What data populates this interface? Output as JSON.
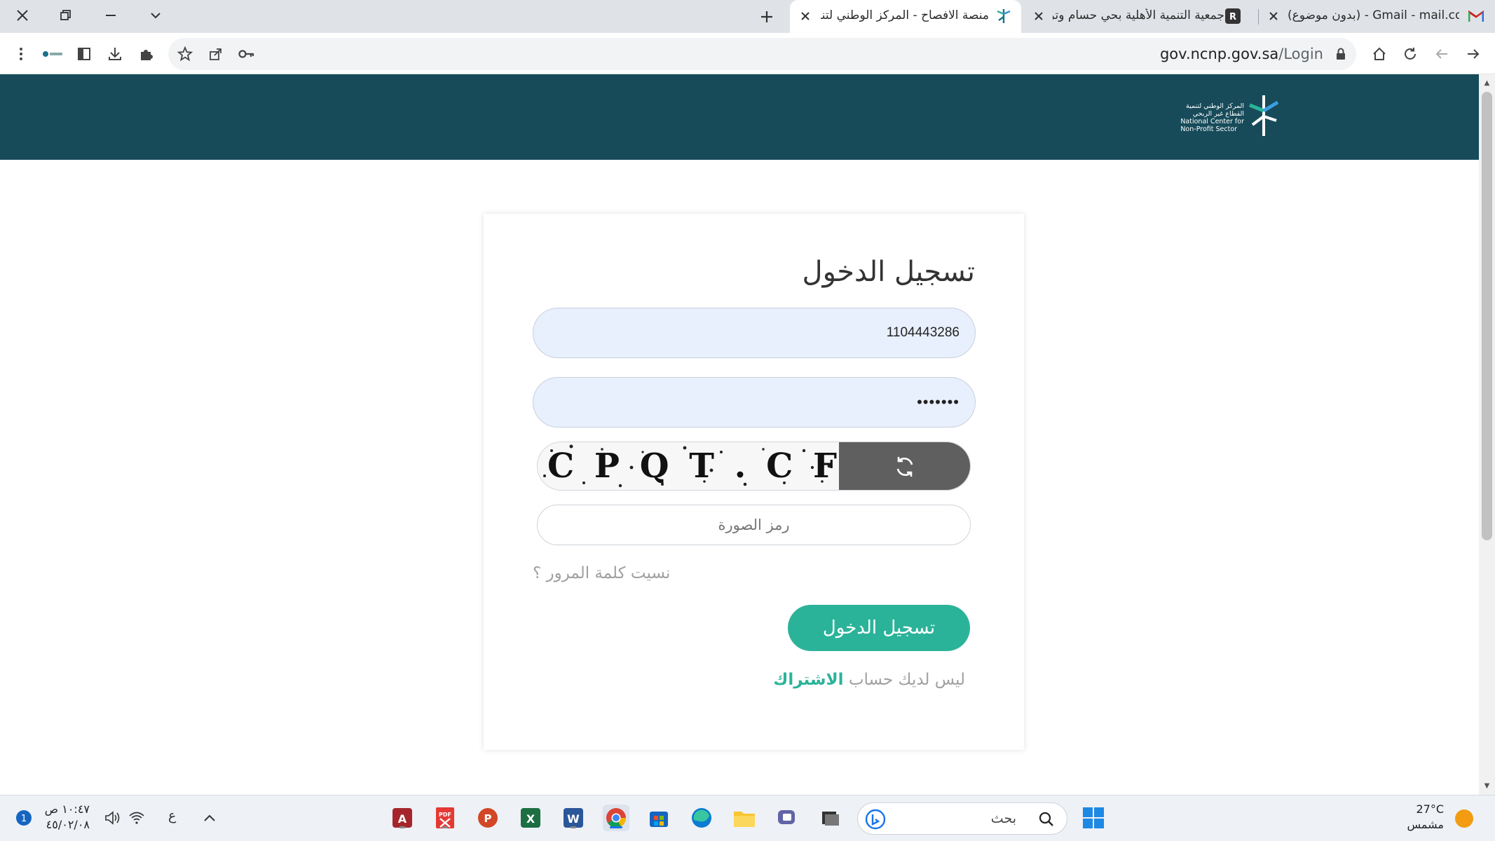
{
  "browser": {
    "tabs": [
      {
        "title": "منصة الافصاح - المركز الوطني لتنمية",
        "active": true
      },
      {
        "title": "جمعية التنمية الأهلية بحي حسام وتر",
        "active": false
      },
      {
        "title": "(بدون موضوع) - Gmail - mail.com",
        "active": false
      }
    ],
    "url_host": "gov.ncnp.gov.sa",
    "url_path": "/Login"
  },
  "header": {
    "logo_text_ar_1": "المركز الوطني لتنمية",
    "logo_text_ar_2": "القطاع غير الربحي",
    "logo_text_en_1": "National Center for",
    "logo_text_en_2": "Non-Profit Sector",
    "background_color": "#174b5a"
  },
  "login": {
    "title": "تسجيل الدخول",
    "username_value": "1104443286",
    "password_value": "•••••••",
    "captcha_text": "C P Q T . C F",
    "captcha_placeholder": "رمز الصورة",
    "forgot_password": "نسيت كلمة المرور ؟",
    "submit_label": "تسجيل الدخول",
    "no_account_text": "ليس لديك حساب",
    "signup_label": "الاشتراك",
    "accent_color": "#2bb39a"
  },
  "taskbar": {
    "search_label": "بحث",
    "language": "ع",
    "time": "١٠:٤٧ ص",
    "date": "٤٥/٠٢/٠٨",
    "temperature": "27°C",
    "weather_label": "مشمس"
  }
}
